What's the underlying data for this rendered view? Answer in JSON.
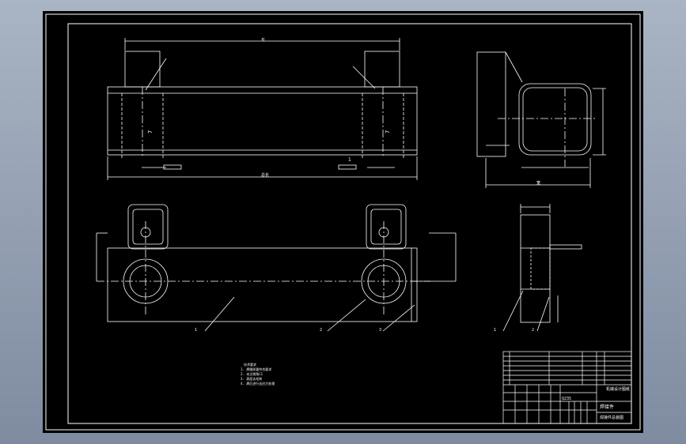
{
  "colors": {
    "background_gradient_top": "#a9b4c4",
    "background_gradient_bottom": "#7f8ba0",
    "sheet": "#000000",
    "line": "#ffffff",
    "hidden_line": "#cfcfcf"
  },
  "views": {
    "front": {
      "number_label": "1",
      "dim_top": "长",
      "dim_bottom": "总长"
    },
    "side": {
      "dim_bottom": "宽"
    },
    "plan": {
      "callouts": [
        "1",
        "2",
        "3"
      ]
    },
    "section": {
      "callouts": [
        "1",
        "2"
      ]
    }
  },
  "notes": {
    "heading": "技术要求",
    "lines": [
      "1. 焊缝质量符合要求",
      "2. 未注倒角C1",
      "3. 表面去毛刺",
      "4. 焊后进行去应力处理"
    ]
  },
  "title_block": {
    "drawing_title": "焊接件",
    "company": "机械设计图纸",
    "material": "Q235",
    "drawing_no": "焊接件总装图"
  }
}
